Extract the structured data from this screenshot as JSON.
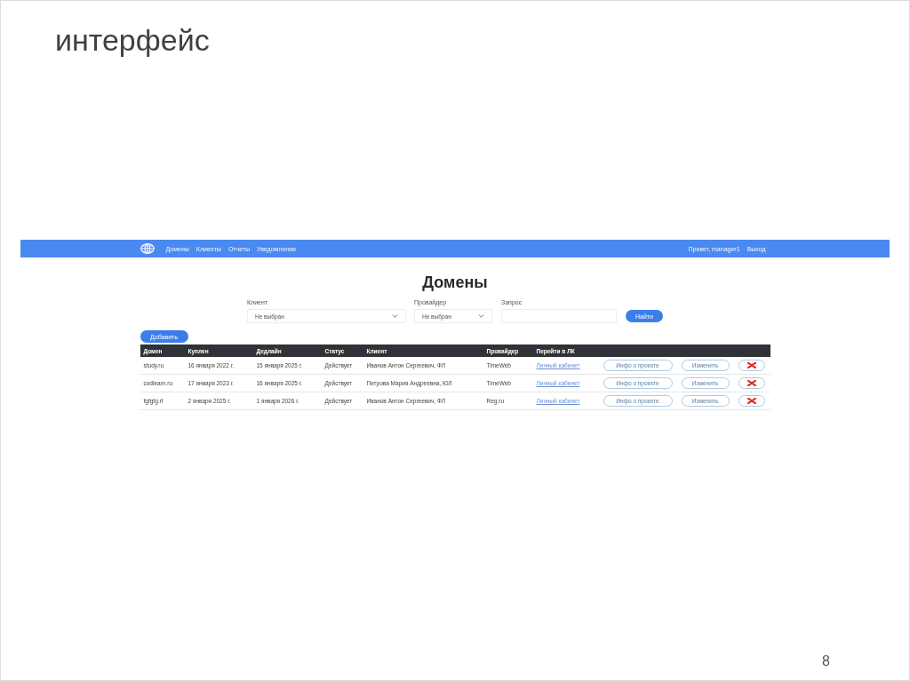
{
  "slide": {
    "title": "интерфейс",
    "page_number": "8"
  },
  "navbar": {
    "links": [
      "Домены",
      "Клиенты",
      "Отчеты",
      "Уведомления"
    ],
    "greeting": "Привет, manager1",
    "logout": "Выход"
  },
  "page": {
    "heading": "Домены",
    "filters": [
      {
        "kind": "select",
        "label": "Клиент",
        "value": "Не выбран"
      },
      {
        "kind": "select",
        "label": "Провайдер",
        "value": "Не выбран"
      },
      {
        "kind": "text",
        "label": "Запрос"
      }
    ],
    "search_button": "Найти",
    "add_button": "Добавить"
  },
  "table": {
    "columns": [
      "Домен",
      "Куплен",
      "Дедлайн",
      "Статус",
      "Клиент",
      "Провайдер",
      "Перейти в ЛК"
    ],
    "rows": [
      {
        "domain": "study.ru",
        "purchased": "16 января 2022 г.",
        "deadline": "15 января 2025 г.",
        "status": "Действует",
        "client": "Иванов Антон Сергеевич, ФЛ",
        "provider": "TimeWeb",
        "link": "Личный кабинет",
        "info_button": "Инфо о проекте",
        "edit_button": "Изменить"
      },
      {
        "domain": "codlearn.ru",
        "purchased": "17 января 2023 г.",
        "deadline": "16 января 2025 г.",
        "status": "Действует",
        "client": "Петрова Мария Андреевна, ЮЛ",
        "provider": "TimeWeb",
        "link": "Личный кабинет",
        "info_button": "Инфо о проекте",
        "edit_button": "Изменить"
      },
      {
        "domain": "fgfgfg.rt",
        "purchased": "2 января 2025 г.",
        "deadline": "1 января 2026 г.",
        "status": "Действует",
        "client": "Иванов Антон Сергеевич, ФЛ",
        "provider": "Reg.ru",
        "link": "Личный кабинет",
        "info_button": "Инфо о проекте",
        "edit_button": "Изменить"
      }
    ]
  }
}
